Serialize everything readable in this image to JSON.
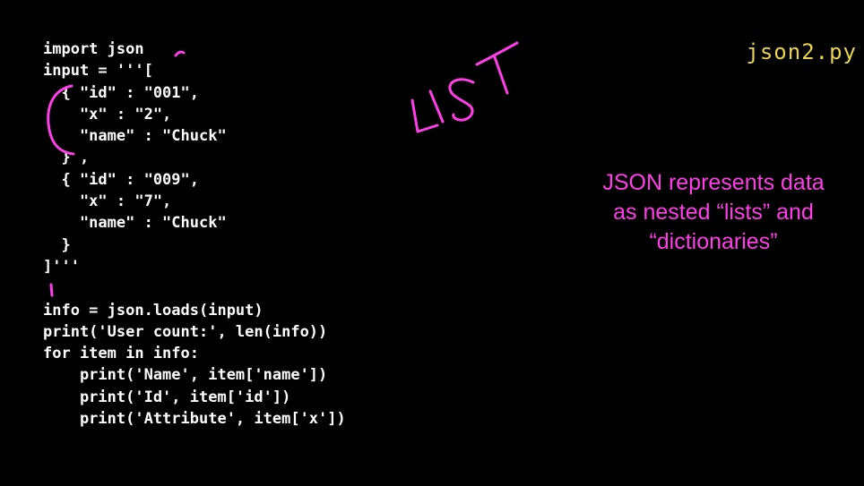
{
  "filename": "json2.py",
  "code_lines": [
    "import json",
    "input = '''[",
    "  { \"id\" : \"001\",",
    "    \"x\" : \"2\",",
    "    \"name\" : \"Chuck\"",
    "  } ,",
    "  { \"id\" : \"009\",",
    "    \"x\" : \"7\",",
    "    \"name\" : \"Chuck\"",
    "  }",
    "]'''",
    "",
    "info = json.loads(input)",
    "print('User count:', len(info))",
    "for item in info:",
    "    print('Name', item['name'])",
    "    print('Id', item['id'])",
    "    print('Attribute', item['x'])"
  ],
  "caption_lines": [
    "JSON represents data",
    "as nested “lists” and",
    "“dictionaries”"
  ],
  "handwritten_annotation": "LIST",
  "colors": {
    "background": "#000000",
    "code": "#ffffff",
    "filename": "#e8d44d",
    "caption": "#ff3ee8",
    "ink": "#ff3ee8"
  }
}
